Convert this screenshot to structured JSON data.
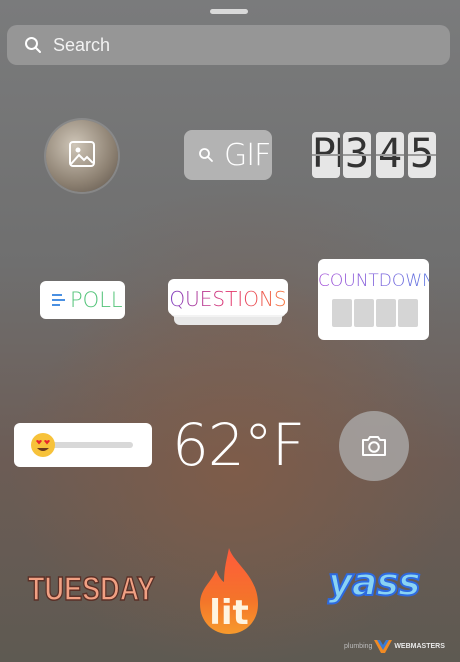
{
  "search": {
    "placeholder": "Search"
  },
  "stickers": {
    "gif": "GIF",
    "clock": {
      "meridiem": "PM",
      "digits": [
        "3",
        "4",
        "5"
      ]
    },
    "poll": "POLL",
    "questions": "QUESTIONS",
    "countdown": "COUNTDOWN",
    "temperature": "62°F",
    "day": "TUESDAY",
    "lit": "lit",
    "yass": "yass"
  },
  "watermark": {
    "prefix": "plumbing",
    "brand": "WEBMASTERS"
  },
  "colors": {
    "poll": "#54c47a",
    "countdown": "#8a5be0",
    "day": "#f1a083",
    "yass": "#8ad3f4"
  }
}
